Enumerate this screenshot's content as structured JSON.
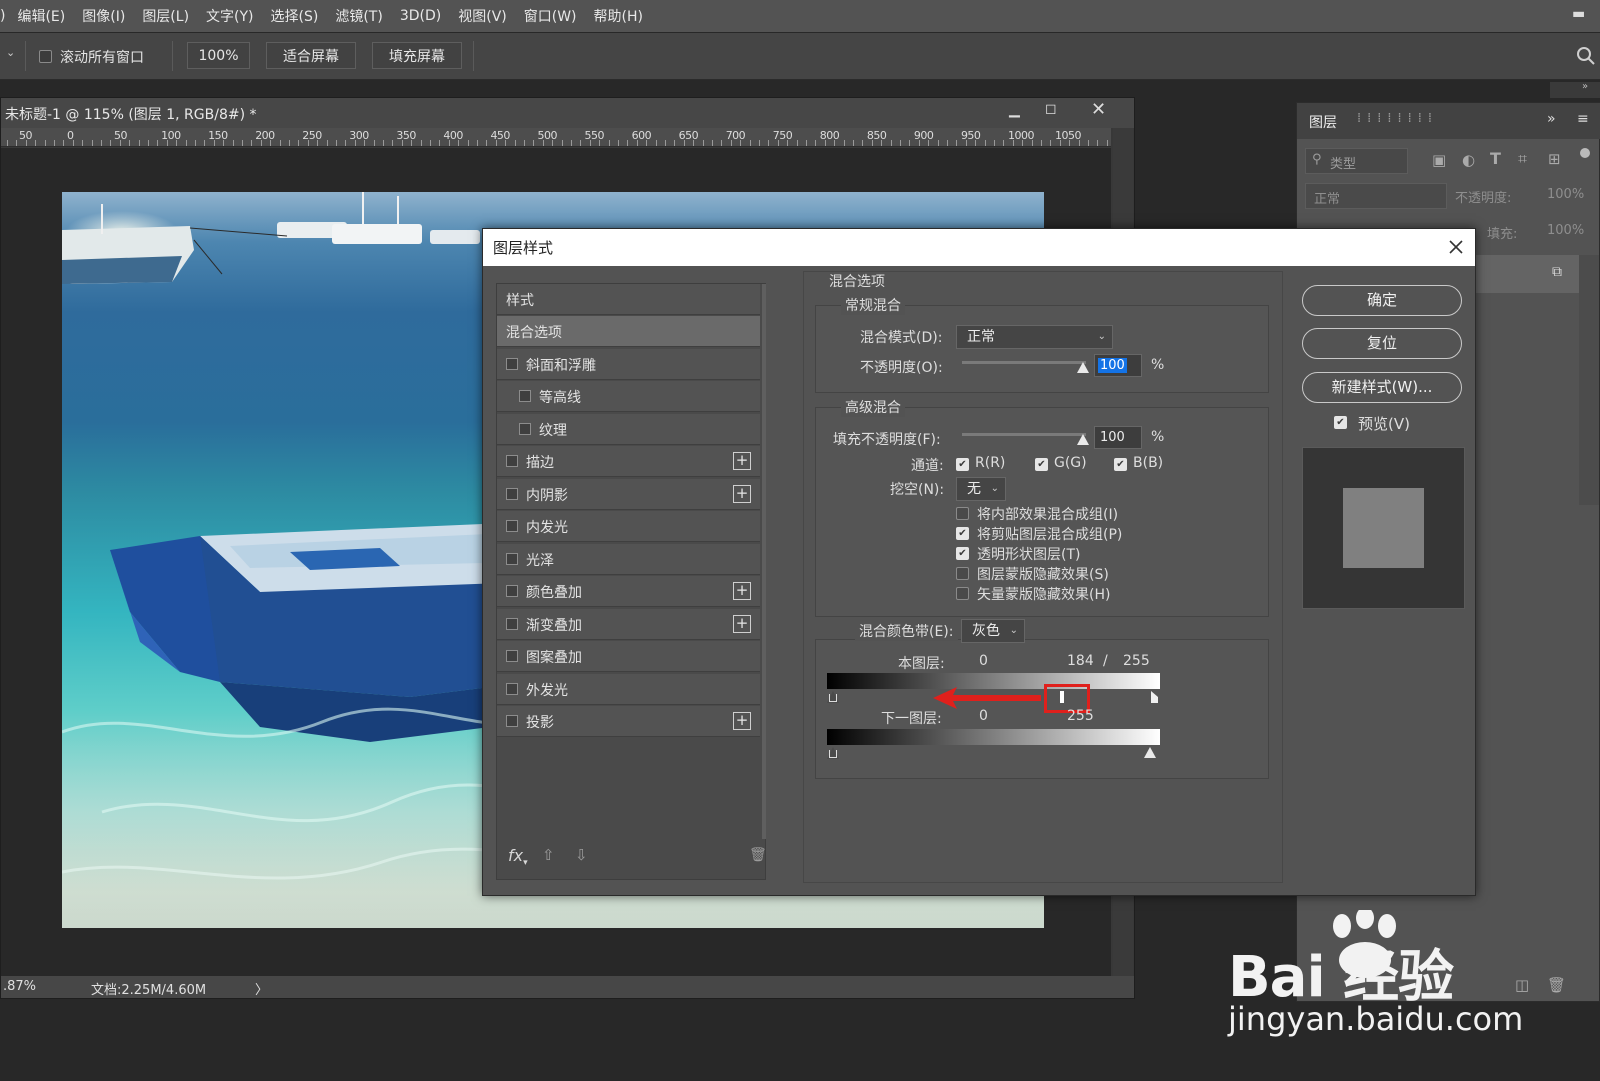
{
  "menu": {
    "items": [
      ")",
      "编辑(E)",
      "图像(I)",
      "图层(L)",
      "文字(Y)",
      "选择(S)",
      "滤镜(T)",
      "3D(D)",
      "视图(V)",
      "窗口(W)",
      "帮助(H)"
    ]
  },
  "options_bar": {
    "scroll_all_label": "滚动所有窗口",
    "zoom_label": "100%",
    "fit_screen_label": "适合屏幕",
    "fill_screen_label": "填充屏幕"
  },
  "document": {
    "title": "未标题-1 @ 115% (图层 1, RGB/8#) *",
    "ruler_labels": [
      "50",
      "0",
      "50",
      "100",
      "150",
      "200",
      "250",
      "300",
      "350",
      "400",
      "450",
      "500",
      "550",
      "600",
      "650",
      "700",
      "750",
      "800",
      "850",
      "900",
      "950",
      "1000",
      "1050"
    ],
    "status_zoom": ".87%",
    "status_doc": "文档:2.25M/4.60M",
    "status_arrow": "〉"
  },
  "layers_panel": {
    "tab": "图层",
    "filter_placeholder": "类型",
    "blend_mode": "正常",
    "opacity_label": "不透明度:",
    "opacity_value": "100%",
    "fill_label": "填充:",
    "fill_value": "100%"
  },
  "dialog": {
    "title": "图层样式",
    "styles_header": "样式",
    "styles": [
      {
        "label": "混合选项",
        "selected": true
      },
      {
        "label": "斜面和浮雕",
        "checkbox": true
      },
      {
        "label": "等高线",
        "checkbox": true,
        "indent": true
      },
      {
        "label": "纹理",
        "checkbox": true,
        "indent": true
      },
      {
        "label": "描边",
        "checkbox": true,
        "plus": true
      },
      {
        "label": "内阴影",
        "checkbox": true,
        "plus": true
      },
      {
        "label": "内发光",
        "checkbox": true
      },
      {
        "label": "光泽",
        "checkbox": true
      },
      {
        "label": "颜色叠加",
        "checkbox": true,
        "plus": true
      },
      {
        "label": "渐变叠加",
        "checkbox": true,
        "plus": true
      },
      {
        "label": "图案叠加",
        "checkbox": true
      },
      {
        "label": "外发光",
        "checkbox": true
      },
      {
        "label": "投影",
        "checkbox": true,
        "plus": true
      }
    ],
    "blend_options": {
      "section_title": "混合选项",
      "general_title": "常规混合",
      "blend_mode_label": "混合模式(D):",
      "blend_mode_value": "正常",
      "opacity_label": "不透明度(O):",
      "opacity_value": "100",
      "percent": "%",
      "advanced_title": "高级混合",
      "fill_opacity_label": "填充不透明度(F):",
      "fill_opacity_value": "100",
      "channels_label": "通道:",
      "channel_r": "R(R)",
      "channel_g": "G(G)",
      "channel_b": "B(B)",
      "knockout_label": "挖空(N):",
      "knockout_value": "无",
      "options": [
        {
          "label": "将内部效果混合成组(I)",
          "checked": false
        },
        {
          "label": "将剪贴图层混合成组(P)",
          "checked": true
        },
        {
          "label": "透明形状图层(T)",
          "checked": true
        },
        {
          "label": "图层蒙版隐藏效果(S)",
          "checked": false
        },
        {
          "label": "矢量蒙版隐藏效果(H)",
          "checked": false
        }
      ],
      "blend_if_label": "混合颜色带(E):",
      "blend_if_value": "灰色",
      "this_layer_label": "本图层:",
      "this_layer_low": "0",
      "this_layer_mid": "184",
      "this_layer_slash": "/",
      "this_layer_high": "255",
      "under_layer_label": "下一图层:",
      "under_layer_low": "0",
      "under_layer_high": "255"
    },
    "buttons": {
      "ok": "确定",
      "reset": "复位",
      "new_style": "新建样式(W)...",
      "preview": "预览(V)"
    }
  },
  "watermark": {
    "brand": "Bai 经验",
    "url": "jingyan.baidu.com"
  },
  "colors": {
    "highlight_box": "#e0201c",
    "arrow": "#e0201c",
    "selection": "#1473e6"
  }
}
